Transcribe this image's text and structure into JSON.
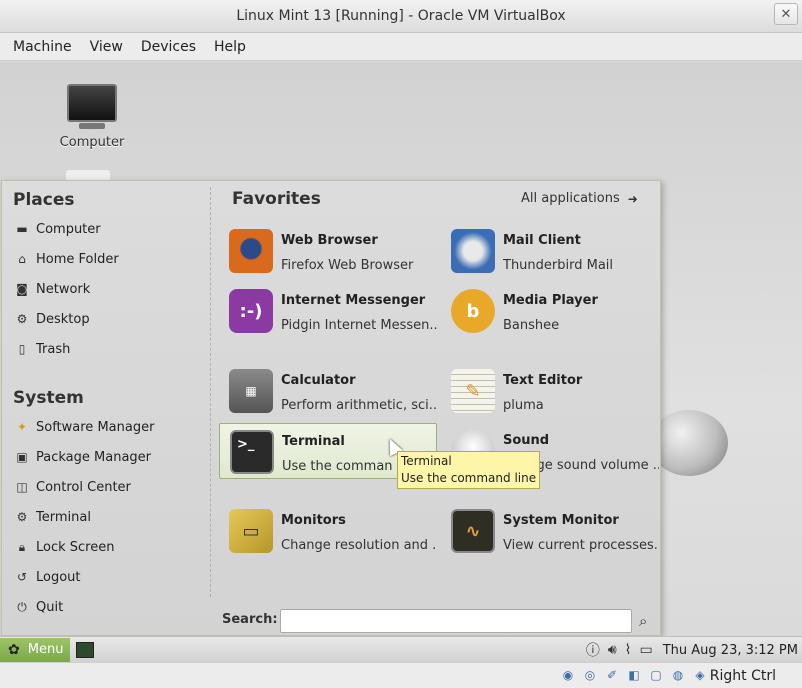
{
  "window": {
    "title": "Linux Mint 13 [Running] - Oracle VM VirtualBox",
    "close_glyph": "✕"
  },
  "menubar": {
    "items": [
      "Machine",
      "View",
      "Devices",
      "Help"
    ]
  },
  "desktop": {
    "icon_label": "Computer"
  },
  "places": {
    "title": "Places",
    "items": [
      {
        "label": "Computer",
        "icon": "monitor-icon"
      },
      {
        "label": "Home Folder",
        "icon": "home-icon"
      },
      {
        "label": "Network",
        "icon": "network-icon"
      },
      {
        "label": "Desktop",
        "icon": "desktop-icon"
      },
      {
        "label": "Trash",
        "icon": "trash-icon"
      }
    ]
  },
  "system": {
    "title": "System",
    "items": [
      {
        "label": "Software Manager",
        "icon": "star-icon"
      },
      {
        "label": "Package Manager",
        "icon": "package-icon"
      },
      {
        "label": "Control Center",
        "icon": "control-icon"
      },
      {
        "label": "Terminal",
        "icon": "terminal-icon"
      },
      {
        "label": "Lock Screen",
        "icon": "lock-icon"
      },
      {
        "label": "Logout",
        "icon": "logout-icon"
      },
      {
        "label": "Quit",
        "icon": "power-icon"
      }
    ]
  },
  "favorites": {
    "title": "Favorites",
    "all_apps": "All applications",
    "apps": [
      {
        "name": "Web Browser",
        "desc": "Firefox Web Browser",
        "icon": "firefox-icon",
        "color": "#d96a1b"
      },
      {
        "name": "Mail Client",
        "desc": "Thunderbird Mail",
        "icon": "thunderbird-icon",
        "color": "#3b6db5"
      },
      {
        "name": "Internet Messenger",
        "desc": "Pidgin Internet Messen...",
        "icon": "pidgin-icon",
        "color": "#8a3aa0"
      },
      {
        "name": "Media Player",
        "desc": "Banshee",
        "icon": "banshee-icon",
        "color": "#e0a128"
      },
      {
        "name": "Calculator",
        "desc": "Perform arithmetic, sci...",
        "icon": "calculator-icon",
        "color": "#6d6d6d"
      },
      {
        "name": "Text Editor",
        "desc": "pluma",
        "icon": "text-editor-icon",
        "color": "#c8c8b4"
      },
      {
        "name": "Terminal",
        "desc": "Use the command line",
        "icon": "terminal-icon",
        "color": "#2a2a2a"
      },
      {
        "name": "Sound",
        "desc": "Change sound volume ...",
        "icon": "sound-icon",
        "color": "#d8d8d8"
      },
      {
        "name": "Monitors",
        "desc": "Change resolution and ...",
        "icon": "monitors-icon",
        "color": "#c9b04a"
      },
      {
        "name": "System Monitor",
        "desc": "View current processes...",
        "icon": "system-monitor-icon",
        "color": "#3a3a2a"
      }
    ]
  },
  "tooltip": {
    "title": "Terminal",
    "desc": "Use the command line"
  },
  "search": {
    "label": "Search:",
    "placeholder": ""
  },
  "panel": {
    "menu_label": "Menu",
    "clock": "Thu Aug 23,  3:12 PM"
  },
  "statusbar": {
    "host_key": "Right Ctrl"
  }
}
